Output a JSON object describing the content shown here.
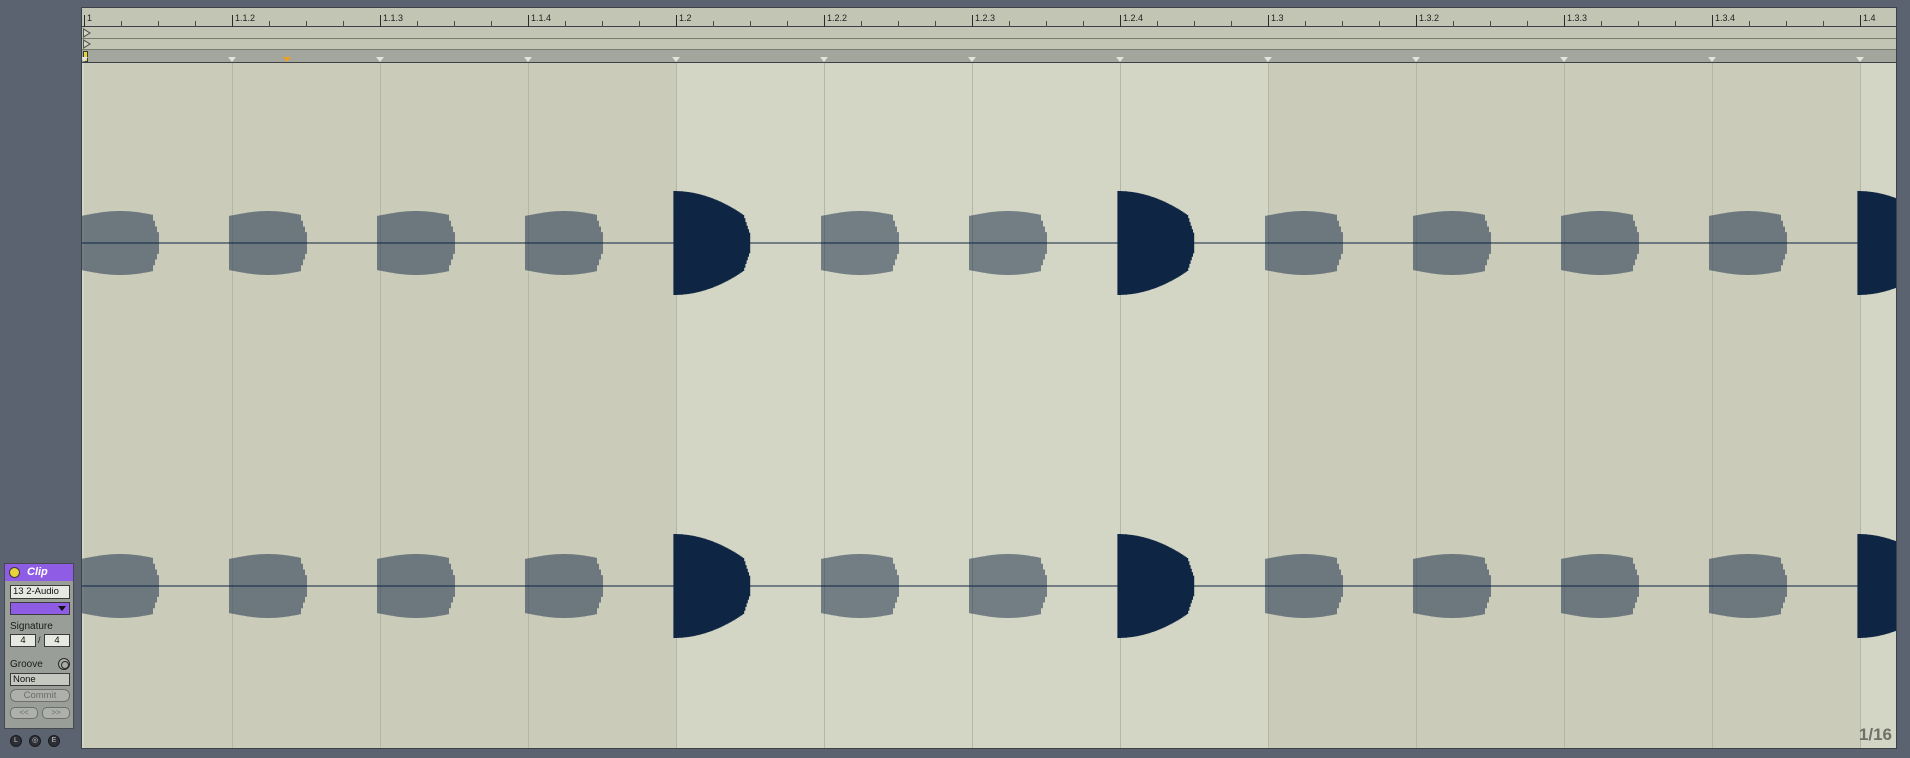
{
  "clip": {
    "title": "Clip",
    "name": "13 2-Audio",
    "color": "#8f5ce6",
    "signature_label": "Signature",
    "signature_numerator": "4",
    "signature_denominator": "4",
    "groove_label": "Groove",
    "groove_value": "None",
    "commit_label": "Commit",
    "nudge_back_label": "<<",
    "nudge_forward_label": ">>"
  },
  "bottom_buttons": [
    {
      "label": "L",
      "icon": "launch-icon"
    },
    {
      "label": "◎",
      "icon": "sample-icon"
    },
    {
      "label": "E",
      "icon": "envelope-icon"
    }
  ],
  "ruler": {
    "labels": [
      "1",
      "1.1.2",
      "1.1.3",
      "1.1.4",
      "1.2",
      "1.2.2",
      "1.2.3",
      "1.2.4",
      "1.3",
      "1.3.2",
      "1.3.3",
      "1.3.4",
      "1.4"
    ]
  },
  "waveform": {
    "color": "#0f2544",
    "background": "#d4d6c5",
    "alternate_background": "#cacbb8",
    "beat_events": [
      {
        "accent": false
      },
      {
        "accent": false
      },
      {
        "accent": false
      },
      {
        "accent": false
      },
      {
        "accent": true
      },
      {
        "accent": false
      },
      {
        "accent": false
      },
      {
        "accent": true
      },
      {
        "accent": false
      },
      {
        "accent": false
      },
      {
        "accent": false
      },
      {
        "accent": false
      },
      {
        "accent": true
      }
    ]
  },
  "warp": {
    "active_marker_color": "#f0a020"
  },
  "zoom_readout": "1/16"
}
